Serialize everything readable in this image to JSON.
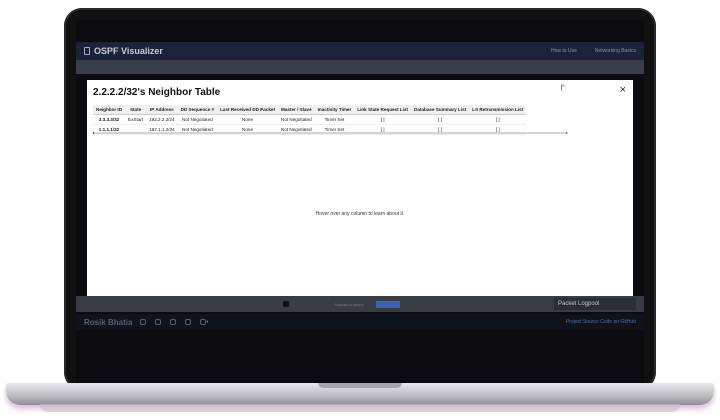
{
  "app": {
    "title": "OSPF Visualizer",
    "nav_links": [
      "How to Use",
      "Networking Basics"
    ],
    "controls": {
      "speed_label": "Animation speed",
      "primary_button": "",
      "secondary_button": ""
    },
    "packet_log_title": "Packet Logpool",
    "footer": {
      "name": "Rosik Bhatia",
      "source_link": "Project Source Code on GitHub"
    }
  },
  "modal": {
    "title": "2.2.2.2/32's Neighbor Table",
    "close_label": "×",
    "columns": [
      "Neighbor ID",
      "State",
      "IP Address",
      "DD Sequence #",
      "Last Received DD Packet",
      "Master / Slave",
      "Inactivity Timer",
      "Link State Request List",
      "Database Summary List",
      "LS Retransmission List"
    ],
    "rows": [
      [
        "3.3.3.3/32",
        "ExStart",
        "192.2.2.2/24",
        "Not Negotiated",
        "None",
        "Not Negotiated",
        "Timer Set",
        "[ ]",
        "[ ]",
        "[ ]"
      ],
      [
        "1.1.1.1/32",
        "",
        "192.1.1.2/24",
        "Not Negotiated",
        "None",
        "Not Negotiated",
        "Timer Set",
        "[ ]",
        "[ ]",
        "[ ]"
      ]
    ],
    "hint": "Hover over any column to learn about it."
  }
}
